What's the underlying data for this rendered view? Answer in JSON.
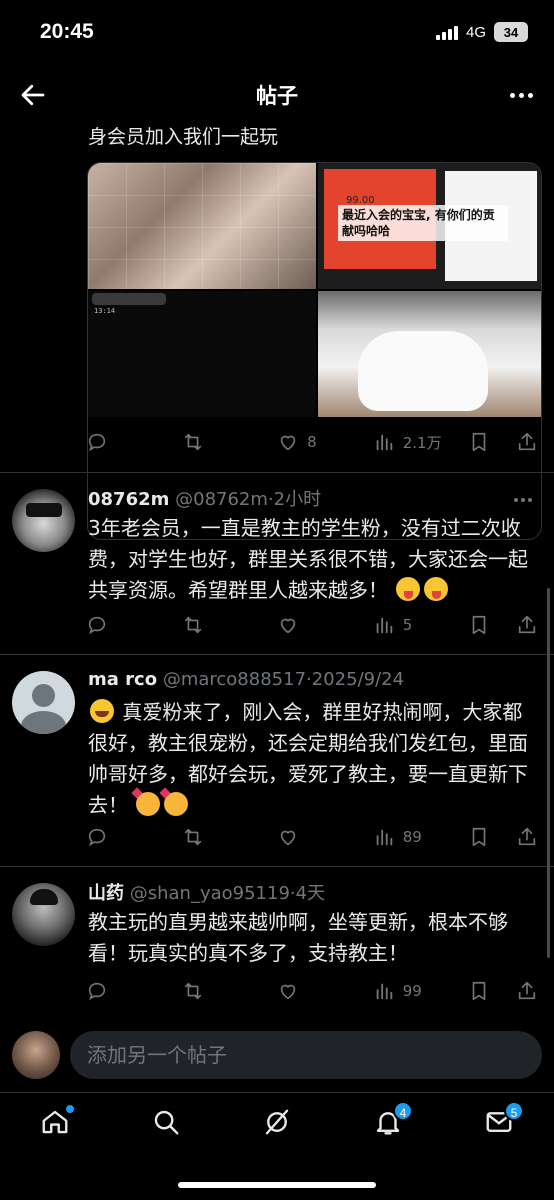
{
  "status_bar": {
    "time": "20:45",
    "network": "4G",
    "battery": "34"
  },
  "header": {
    "title": "帖子"
  },
  "main_post": {
    "text_tail": "身会员加入我们一起玩",
    "media": [
      {
        "icon": "photo-collage-hands"
      },
      {
        "caption": "最近入会的宝宝, 有你们的贡献吗哈哈",
        "poster_price": "99.00"
      },
      {
        "timestamp": "13:14"
      },
      {
        "icon": "photo-sportswear"
      }
    ],
    "stats": {
      "replies": "",
      "reposts": "",
      "likes": "8",
      "views": "2.1万"
    }
  },
  "replies": [
    {
      "name": "08762m",
      "handle": "@08762m",
      "time": "2小时",
      "text": "3年老会员，一直是教主的学生粉，没有过二次收费，对学生也好，群里关系很不错，大家还会一起共享资源。希望群里人越来越多！",
      "emojis": [
        "squinting-tongue",
        "squinting-tongue"
      ],
      "stats": {
        "views": "5"
      }
    },
    {
      "name": "ma rco",
      "handle": "@marco888517",
      "time": "2025/9/24",
      "text": "真爱粉来了，刚入会，群里好热闹啊，大家都很好，教主很宠粉，还会定期给我们发红包，里面帅哥好多，都好会玩，爱死了教主，要一直更新下去！",
      "emojis_lead": [
        "rolling-laughing"
      ],
      "emojis": [
        "smiling-hearts",
        "smiling-hearts"
      ],
      "stats": {
        "views": "89"
      }
    },
    {
      "name": "山药",
      "handle": "@shan_yao95119",
      "time": "4天",
      "text": "教主玩的直男越来越帅啊，坐等更新，根本不够看！玩真实的真不多了，支持教主！",
      "stats": {
        "views": "99"
      }
    }
  ],
  "composer": {
    "placeholder": "添加另一个帖子"
  },
  "bottom_nav": {
    "items": [
      {
        "icon": "home-icon",
        "badge": ""
      },
      {
        "icon": "search-icon",
        "badge": ""
      },
      {
        "icon": "grok-icon",
        "badge": ""
      },
      {
        "icon": "bell-icon",
        "badge": "4"
      },
      {
        "icon": "mail-icon",
        "badge": "5"
      }
    ]
  }
}
